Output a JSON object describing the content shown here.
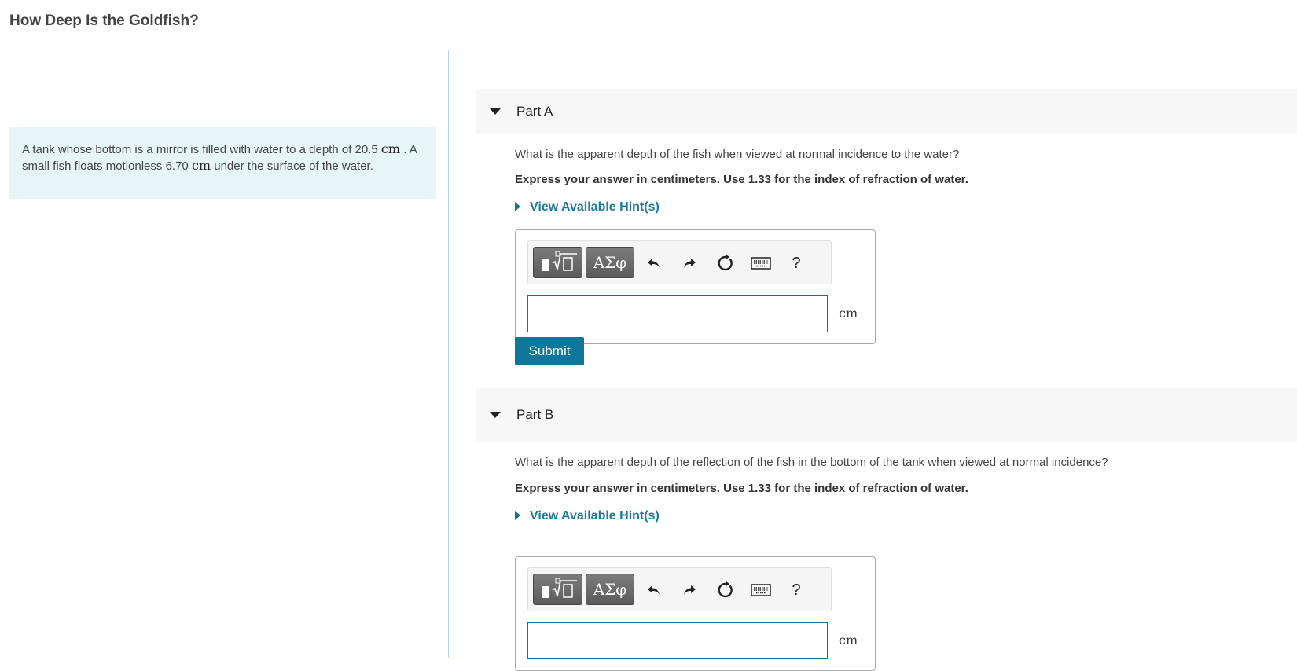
{
  "page": {
    "title": "How Deep Is the Goldfish?"
  },
  "problem": {
    "text_1": "A tank whose bottom is a mirror is filled with water to a depth of 20.5",
    "unit_1": "cm",
    "text_2": ". A small fish floats motionless 6.70",
    "unit_2": "cm",
    "text_3": "under the surface of the water."
  },
  "parts": [
    {
      "label": "Part A",
      "question": "What is the apparent depth of the fish when viewed at normal incidence to the water?",
      "instruction": "Express your answer in centimeters. Use 1.33 for the index of refraction of water.",
      "hint_label": "View Available Hint(s)",
      "toolbar": {
        "symbols_label": "ΑΣφ",
        "help_label": "?"
      },
      "answer_value": "",
      "unit": "cm",
      "submit_label": "Submit"
    },
    {
      "label": "Part B",
      "question": "What is the apparent depth of the reflection of the fish in the bottom of the tank when viewed at normal incidence?",
      "instruction": "Express your answer in centimeters. Use 1.33 for the index of refraction of water.",
      "hint_label": "View Available Hint(s)",
      "toolbar": {
        "symbols_label": "ΑΣφ",
        "help_label": "?"
      },
      "answer_value": "",
      "unit": "cm"
    }
  ],
  "colors": {
    "accent": "#0f7799",
    "hint_link": "#1a7a9e",
    "problem_bg": "#e6f5f5"
  }
}
